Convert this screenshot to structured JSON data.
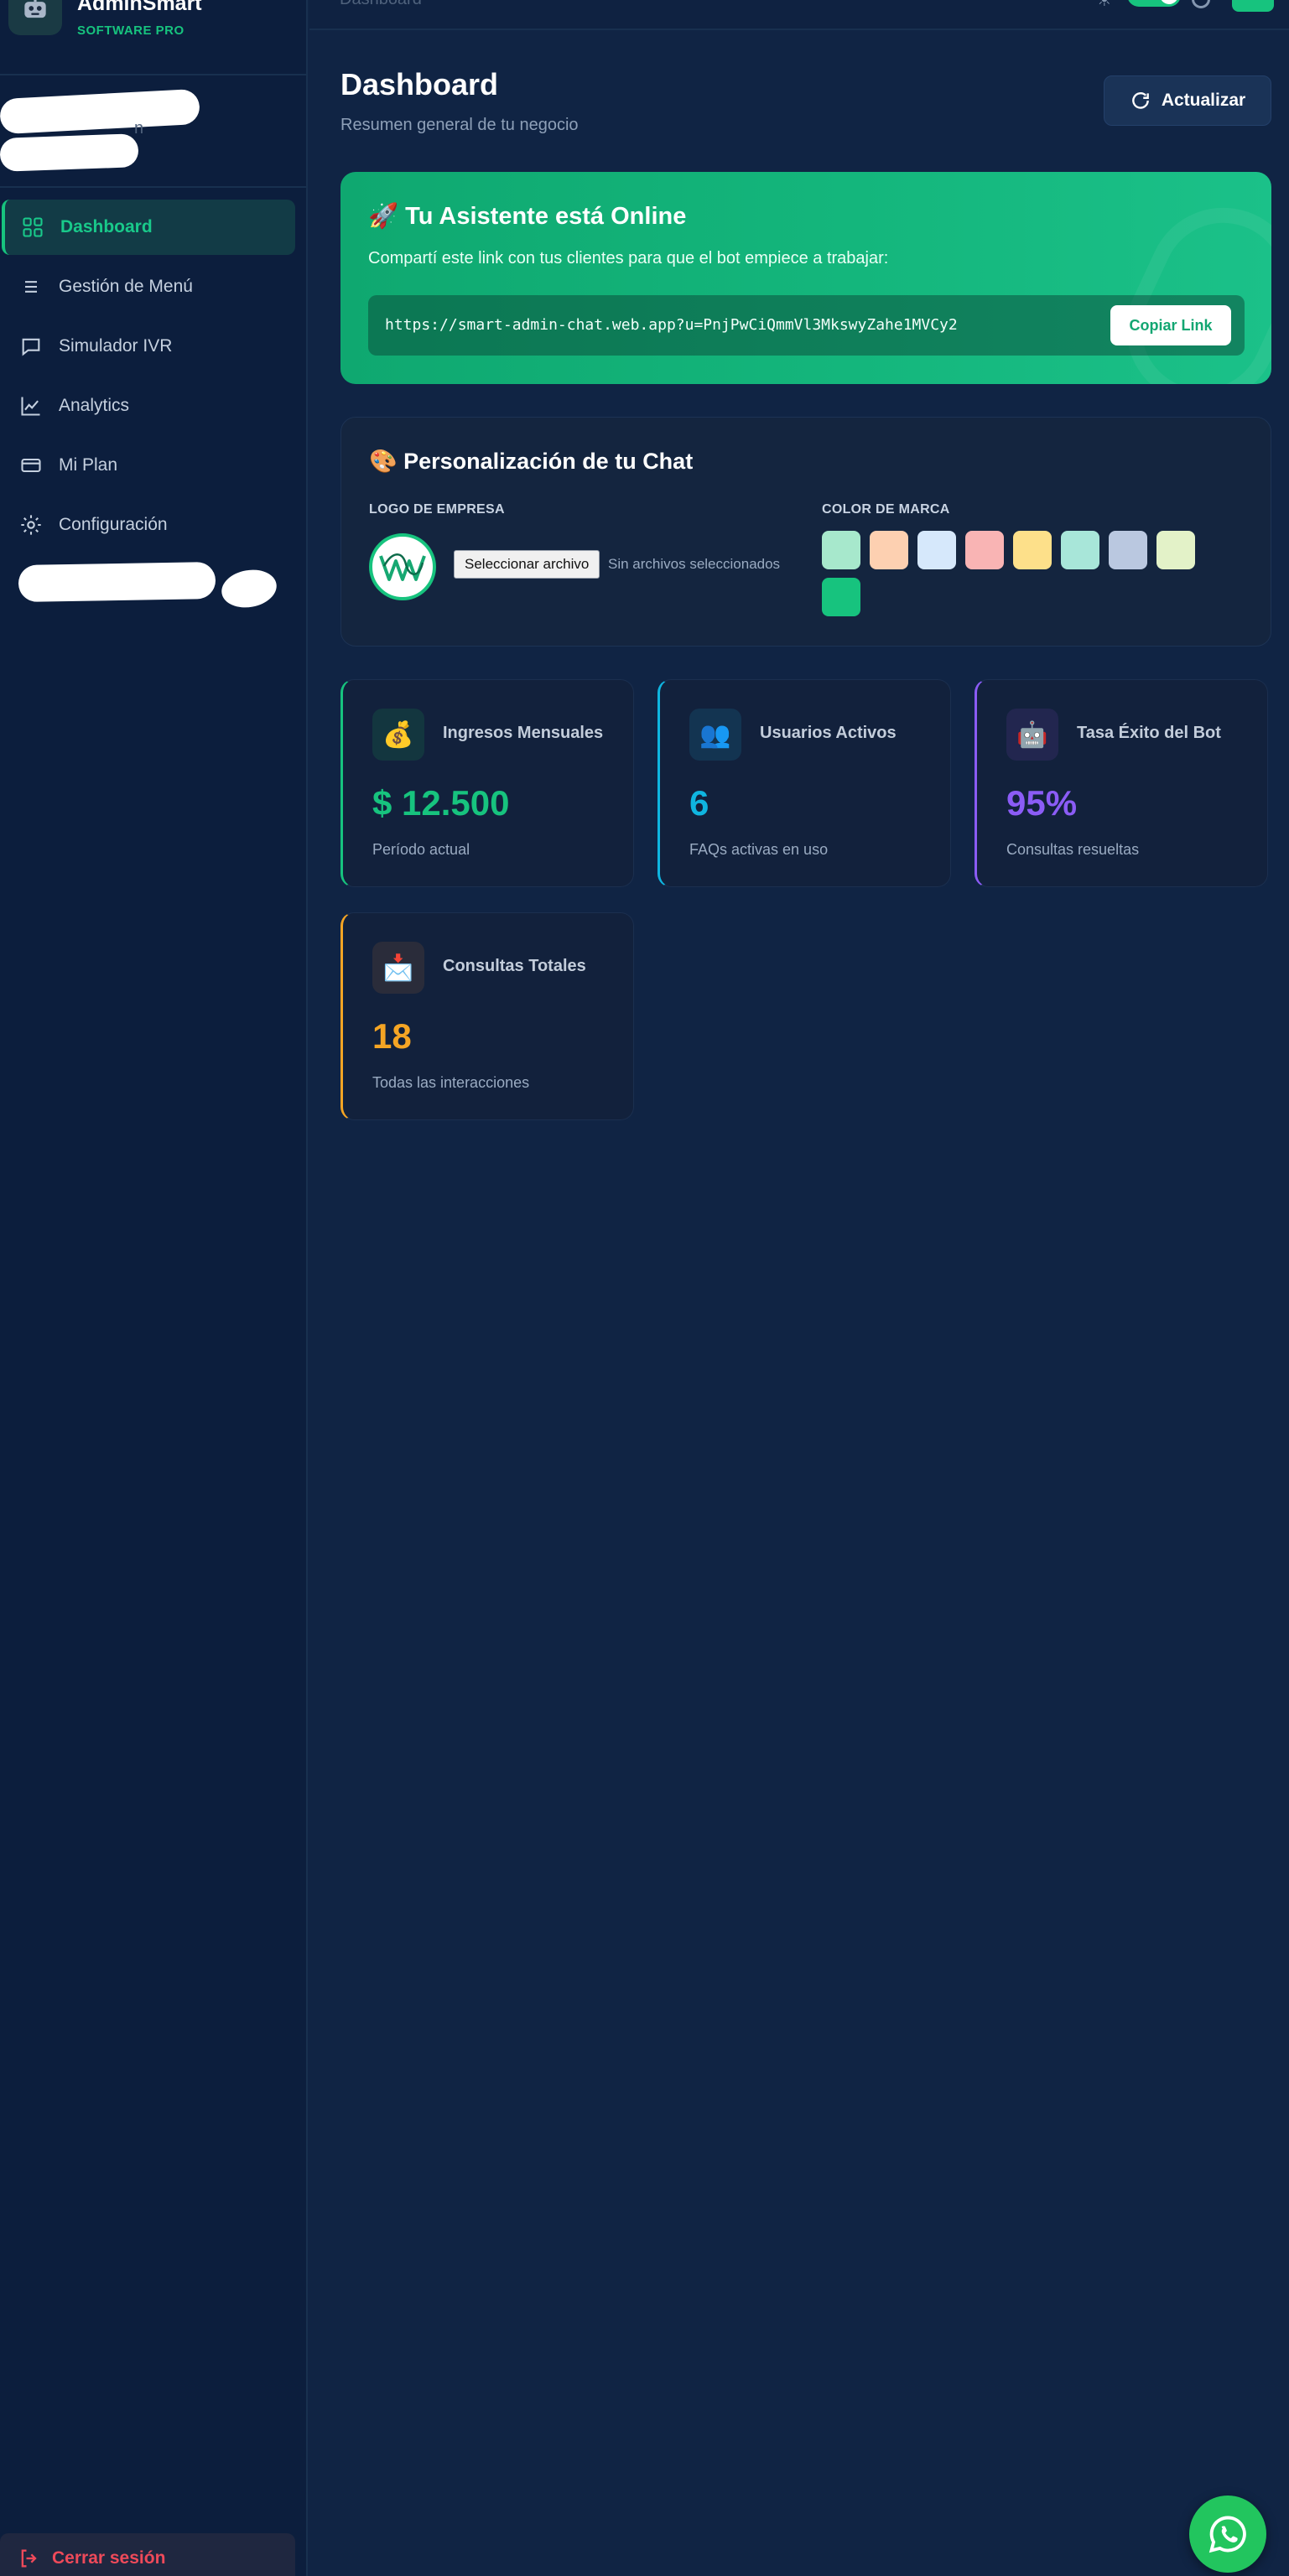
{
  "brand": {
    "name": "AdminSmart",
    "subtitle": "SOFTWARE PRO",
    "logo_icon": "robot-icon"
  },
  "user": {
    "role": "n"
  },
  "topbar": {
    "title": "Dashboard"
  },
  "nav": {
    "items": [
      {
        "label": "Dashboard",
        "icon": "grid-icon",
        "active": true
      },
      {
        "label": "Gestión de Menú",
        "icon": "menu-icon"
      },
      {
        "label": "Simulador IVR",
        "icon": "chat-icon"
      },
      {
        "label": "Analytics",
        "icon": "chart-icon"
      },
      {
        "label": "Mi Plan",
        "icon": "card-icon"
      },
      {
        "label": "Configuración",
        "icon": "gear-icon"
      }
    ],
    "logout": "Cerrar sesión"
  },
  "header": {
    "title": "Dashboard",
    "subtitle": "Resumen general de tu negocio",
    "refresh_label": "Actualizar"
  },
  "online": {
    "title": "🚀 Tu Asistente está Online",
    "description": "Compartí este link con tus clientes para que el bot empiece a trabajar:",
    "link": "https://smart-admin-chat.web.app?u=PnjPwCiQmmVl3MkswyZahe1MVCy2",
    "copy_label": "Copiar Link"
  },
  "customization": {
    "title": "🎨 Personalización de tu Chat",
    "logo_label": "LOGO DE EMPRESA",
    "file_button": "Seleccionar archivo",
    "file_status": "Sin archivos seleccionados",
    "color_label": "COLOR DE MARCA",
    "colors": [
      "#a7e8cc",
      "#fdd0b1",
      "#d6e8fb",
      "#f9b4b4",
      "#fde08a",
      "#a8e6d9",
      "#bac8e0",
      "#e3f2c8",
      "#17c37e"
    ]
  },
  "stats": [
    {
      "icon": "💰",
      "label": "Ingresos Mensuales",
      "value": "$ 12.500",
      "sub": "Período actual",
      "color": "#17c37e",
      "icon_bg": "#13363f"
    },
    {
      "icon": "👥",
      "label": "Usuarios Activos",
      "value": "6",
      "sub": "FAQs activas en uso",
      "color": "#0fb5e0",
      "icon_bg": "#133451"
    },
    {
      "icon": "🤖",
      "label": "Tasa Éxito del Bot",
      "value": "95%",
      "sub": "Consultas resueltas",
      "color": "#8b5cf6",
      "icon_bg": "#22264f"
    },
    {
      "icon": "📩",
      "label": "Consultas Totales",
      "value": "18",
      "sub": "Todas las interacciones",
      "color": "#f5a524",
      "icon_bg": "#2a2c3a"
    }
  ]
}
